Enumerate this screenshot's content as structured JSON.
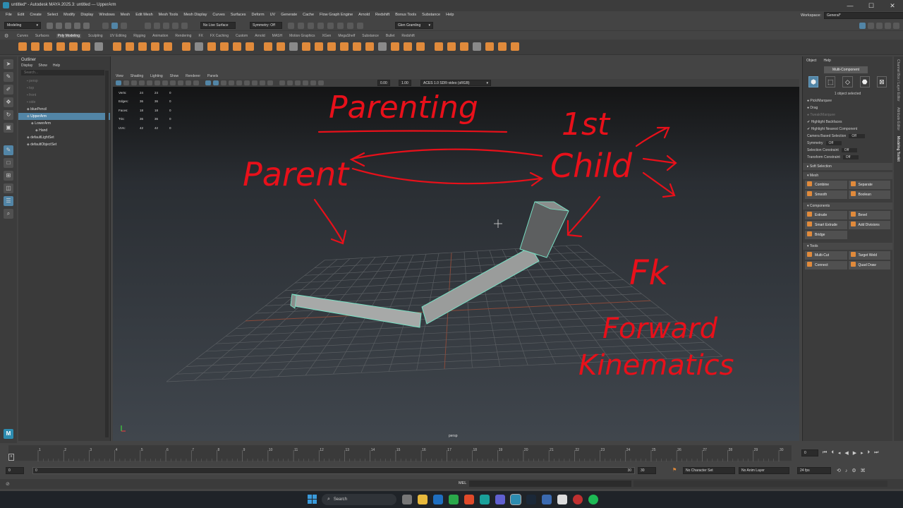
{
  "window": {
    "title": "untitled* - Autodesk MAYA 2025.3: untitled   ---   UpperArm",
    "minimize": "—",
    "maximize": "☐",
    "close": "✕"
  },
  "menubar": [
    "File",
    "Edit",
    "Create",
    "Select",
    "Modify",
    "Display",
    "Windows",
    "Mesh",
    "Edit Mesh",
    "Mesh Tools",
    "Mesh Display",
    "Curves",
    "Surfaces",
    "Deform",
    "UV",
    "Generate",
    "Cache",
    "Flow Graph Engine",
    "Arnold",
    "Redshift",
    "Bonus Tools",
    "Substance",
    "Help"
  ],
  "workspace": {
    "label": "Workspace:",
    "value": "General*"
  },
  "statusline": {
    "menuset": "Modeling",
    "live_surface": "No Live Surface",
    "symmetry": "Symmetry: Off",
    "user": "Glen Gramling"
  },
  "shelf_tabs": [
    "Curves",
    "Surfaces",
    "Poly Modeling",
    "Sculpting",
    "UV Editing",
    "Rigging",
    "Animation",
    "Rendering",
    "FX",
    "FX Caching",
    "Custom",
    "Arnold",
    "MASH",
    "Motion Graphics",
    "XGen",
    "MegaShelf",
    "Substance",
    "Bullet",
    "Redshift"
  ],
  "shelf_active": "Poly Modeling",
  "outliner": {
    "title": "Outliner",
    "menu": [
      "Display",
      "Show",
      "Help"
    ],
    "search_placeholder": "Search...",
    "items": [
      {
        "label": "persp",
        "dim": true,
        "indent": 1
      },
      {
        "label": "top",
        "dim": true,
        "indent": 1
      },
      {
        "label": "front",
        "dim": true,
        "indent": 1
      },
      {
        "label": "side",
        "dim": true,
        "indent": 1
      },
      {
        "label": "bluePencil",
        "dim": false,
        "indent": 1
      },
      {
        "label": "UpperArm",
        "dim": false,
        "indent": 1,
        "selected": true
      },
      {
        "label": "LowerArm",
        "dim": false,
        "indent": 2
      },
      {
        "label": "Hand",
        "dim": false,
        "indent": 3
      },
      {
        "label": "defaultLightSet",
        "dim": false,
        "indent": 1
      },
      {
        "label": "defaultObjectSet",
        "dim": false,
        "indent": 1
      }
    ]
  },
  "panel_menu": [
    "View",
    "Shading",
    "Lighting",
    "Show",
    "Renderer",
    "Panels"
  ],
  "panel_toolbar": {
    "num1": "0.00",
    "num2": "1.00",
    "colorspace": "ACES 1.0 SDR-video (sRGB)"
  },
  "hud": {
    "rows": [
      {
        "label": "Verts:",
        "a": "24",
        "b": "24",
        "c": "0"
      },
      {
        "label": "Edges:",
        "a": "36",
        "b": "36",
        "c": "0"
      },
      {
        "label": "Faces:",
        "a": "18",
        "b": "18",
        "c": "0"
      },
      {
        "label": "Tris:",
        "a": "36",
        "b": "36",
        "c": "0"
      },
      {
        "label": "UVs:",
        "a": "42",
        "b": "42",
        "c": "0"
      }
    ],
    "camera": "persp"
  },
  "annotations": {
    "parenting": "Parenting",
    "parent": "Parent",
    "first": "1st",
    "child": "Child",
    "fk": "Fk",
    "forward": "Forward",
    "kinematics": "Kinematics"
  },
  "attribute_panel": {
    "tabs": [
      "Object",
      "Help"
    ],
    "title": "Multi-Component",
    "selected_info": "1 object selected",
    "options": [
      {
        "label": "Pick/Marquee",
        "dim": false
      },
      {
        "label": "Drag",
        "dim": false
      },
      {
        "label": "Tweak/Marquee",
        "dim": true
      },
      {
        "label": "Highlight Backfaces",
        "dim": false
      },
      {
        "label": "Highlight Nearest Component",
        "dim": false
      }
    ],
    "settings": [
      {
        "label": "Camera Based Selection",
        "value": "Off"
      },
      {
        "label": "Symmetry",
        "value": "Off"
      },
      {
        "label": "Selection Constraint",
        "value": "Off"
      },
      {
        "label": "Transform Constraint",
        "value": "Off"
      }
    ],
    "soft_selection": "Soft Selection",
    "sections": [
      {
        "title": "Mesh",
        "tools": [
          "Combine",
          "Separate",
          "Smooth",
          "Boolean"
        ]
      },
      {
        "title": "Components",
        "tools": [
          "Extrude",
          "Bevel",
          "Smart Extrude",
          "Add Divisions",
          "Bridge"
        ]
      },
      {
        "title": "Tools",
        "tools": [
          "Multi-Cut",
          "Target Weld",
          "Connect",
          "Quad Draw"
        ]
      }
    ]
  },
  "side_tabs": [
    "Channel Box / Layer Editor",
    "Attribute Editor",
    "Modeling Toolkit"
  ],
  "side_tab_active": "Modeling Toolkit",
  "timeline": {
    "ticks": [
      "1",
      "2",
      "3",
      "4",
      "5",
      "6",
      "7",
      "8",
      "9",
      "10",
      "11",
      "12",
      "13",
      "14",
      "15",
      "16",
      "17",
      "18",
      "19",
      "20",
      "21",
      "22",
      "23",
      "24",
      "25",
      "26",
      "27",
      "28",
      "29",
      "30"
    ],
    "current_frame": "0",
    "range_start": "0",
    "range_inner_start": "0",
    "range_inner_end": "30",
    "range_end": "30",
    "character_set": "No Character Set",
    "anim_layer": "No Anim Layer",
    "fps": "24 fps"
  },
  "command_line": {
    "label": "MEL"
  },
  "taskbar": {
    "search": "Search"
  },
  "colors": {
    "accent": "#5285a6",
    "annotation": "#e8101a",
    "shelf_icon": "#e08a3b",
    "mesh_outline": "#78e0c4"
  }
}
